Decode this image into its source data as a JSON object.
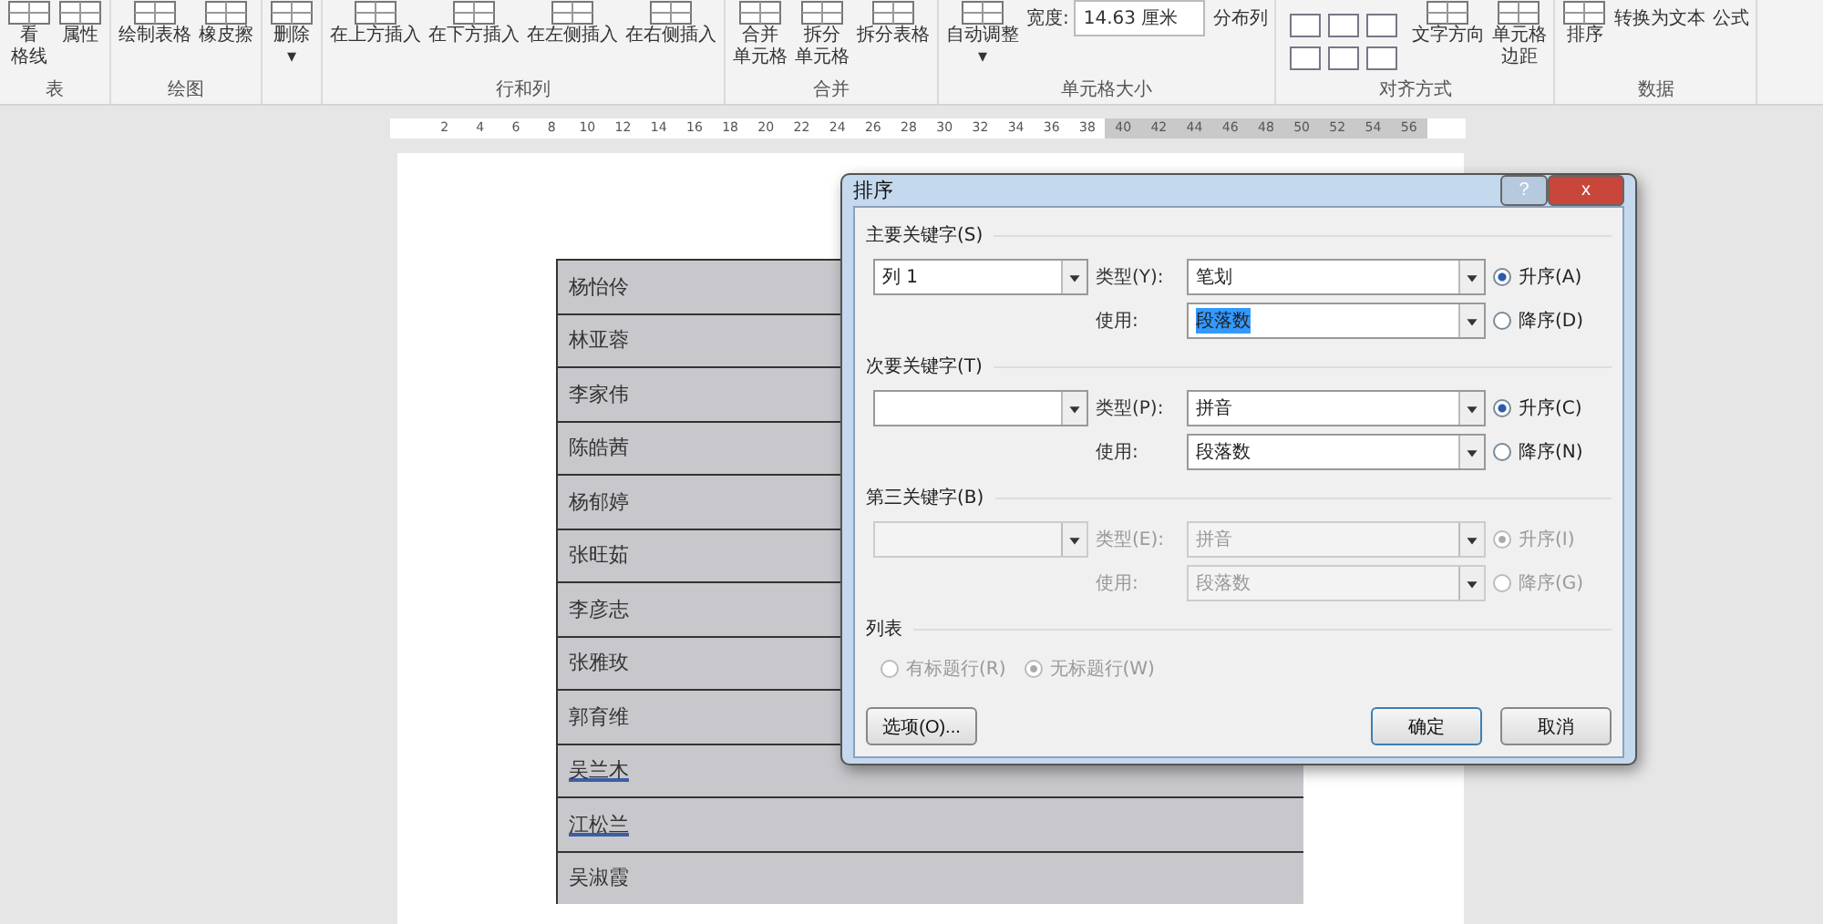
{
  "ribbon": {
    "groups": [
      {
        "label": "表",
        "items": [
          {
            "lines": [
              "看",
              "格线"
            ],
            "kind": "large"
          },
          {
            "lines": [
              "属性"
            ],
            "kind": "large"
          }
        ]
      },
      {
        "label": "绘图",
        "items": [
          {
            "lines": [
              "绘制表格"
            ],
            "kind": "large"
          },
          {
            "lines": [
              "橡皮擦"
            ],
            "kind": "large"
          }
        ]
      },
      {
        "items": [
          {
            "lines": [
              "删除"
            ],
            "caret": "▾",
            "kind": "menu"
          }
        ]
      },
      {
        "label": "行和列",
        "items": [
          {
            "lines": [
              "在上方插入"
            ],
            "kind": "large"
          },
          {
            "lines": [
              "在下方插入"
            ],
            "kind": "large"
          },
          {
            "lines": [
              "在左侧插入"
            ],
            "kind": "large"
          },
          {
            "lines": [
              "在右侧插入"
            ],
            "kind": "large"
          }
        ]
      },
      {
        "label": "合并",
        "items": [
          {
            "lines": [
              "合并",
              "单元格"
            ],
            "kind": "large"
          },
          {
            "lines": [
              "拆分",
              "单元格"
            ],
            "kind": "large"
          },
          {
            "lines": [
              "拆分表格"
            ],
            "kind": "large"
          }
        ]
      },
      {
        "label": "单元格大小",
        "items": [
          {
            "lines": [
              "自动调整"
            ],
            "caret": "▾",
            "kind": "menu"
          },
          {
            "lines": [
              "宽度:"
            ],
            "value": "14.63 厘米",
            "kind": "field"
          },
          {
            "lines": [
              "分布列"
            ],
            "kind": "small"
          }
        ]
      },
      {
        "label": "对齐方式",
        "items": [
          {
            "kind": "align"
          },
          {
            "lines": [
              "文字方向"
            ],
            "kind": "large"
          },
          {
            "lines": [
              "单元格",
              "边距"
            ],
            "kind": "large"
          }
        ]
      },
      {
        "label": "数据",
        "items": [
          {
            "lines": [
              "排序"
            ],
            "kind": "large"
          },
          {
            "lines": [
              "转换为文本"
            ],
            "kind": "small"
          },
          {
            "lines": [
              "公式"
            ],
            "kind": "small"
          }
        ]
      }
    ]
  },
  "ruler": {
    "ticks": [
      "2",
      "4",
      "6",
      "8",
      "10",
      "12",
      "14",
      "16",
      "18",
      "20",
      "22",
      "24",
      "26",
      "28",
      "30",
      "32",
      "34",
      "36",
      "38",
      "40",
      "42",
      "44",
      "46",
      "48",
      "50",
      "52",
      "54",
      "56"
    ]
  },
  "table": {
    "rows": [
      {
        "name": "杨怡伶",
        "selected": true,
        "underlined": false
      },
      {
        "name": "林亚蓉",
        "selected": true,
        "underlined": false
      },
      {
        "name": "李家伟",
        "selected": true,
        "underlined": false
      },
      {
        "name": "陈皓茜",
        "selected": true,
        "underlined": false
      },
      {
        "name": "杨郁婷",
        "selected": true,
        "underlined": false
      },
      {
        "name": "张旺茹",
        "selected": true,
        "underlined": false
      },
      {
        "name": "李彦志",
        "selected": true,
        "underlined": false
      },
      {
        "name": "张雅玫",
        "selected": true,
        "underlined": false
      },
      {
        "name": "郭育维",
        "selected": true,
        "underlined": false
      },
      {
        "name": "吴兰木",
        "selected": true,
        "underlined": true
      },
      {
        "name": "江松兰",
        "selected": true,
        "underlined": true
      },
      {
        "name": "吴淑霞",
        "selected": true,
        "underlined": false
      }
    ]
  },
  "dialog": {
    "title": "排序",
    "help": "?",
    "close": "x",
    "keys": [
      {
        "title": "主要关键字(S)",
        "column": "列 1",
        "type_label": "类型(Y):",
        "type_value": "笔划",
        "using_label": "使用:",
        "using_value": "段落数",
        "disabled": false,
        "highlighted": true,
        "orders": [
          {
            "label": "升序(A)",
            "selected": true
          },
          {
            "label": "降序(D)",
            "selected": false
          }
        ]
      },
      {
        "title": "次要关键字(T)",
        "type_label": "类型(P):",
        "type_value": "拼音",
        "using_label": "使用:",
        "using_value": "段落数",
        "disabled": false,
        "highlighted": false,
        "orders": [
          {
            "label": "升序(C)",
            "selected": true
          },
          {
            "label": "降序(N)",
            "selected": false
          }
        ]
      },
      {
        "title": "第三关键字(B)",
        "type_label": "类型(E):",
        "type_value": "拼音",
        "using_label": "使用:",
        "using_value": "段落数",
        "disabled": true,
        "highlighted": false,
        "orders": [
          {
            "label": "升序(I)",
            "selected": true
          },
          {
            "label": "降序(G)",
            "selected": false
          }
        ]
      }
    ],
    "list": {
      "title": "列表",
      "options": [
        {
          "label": "有标题行(R)",
          "selected": false,
          "disabled": true
        },
        {
          "label": "无标题行(W)",
          "selected": true,
          "disabled": true
        }
      ]
    },
    "buttons": [
      {
        "label": "选项(O)...",
        "kind": "options"
      },
      {
        "label": "确定",
        "kind": "ok"
      },
      {
        "label": "取消",
        "kind": "cancel"
      }
    ]
  }
}
